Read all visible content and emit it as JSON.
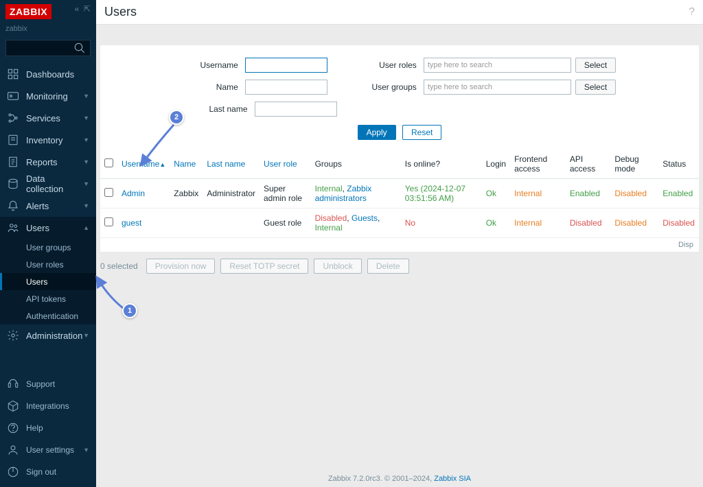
{
  "brand": "ZABBIX",
  "server_name": "zabbix",
  "page_title": "Users",
  "nav": {
    "dashboards": "Dashboards",
    "monitoring": "Monitoring",
    "services": "Services",
    "inventory": "Inventory",
    "reports": "Reports",
    "data_collection": "Data collection",
    "alerts": "Alerts",
    "users": "Users",
    "administration": "Administration",
    "users_sub": {
      "user_groups": "User groups",
      "user_roles": "User roles",
      "users": "Users",
      "api_tokens": "API tokens",
      "authentication": "Authentication"
    },
    "support": "Support",
    "integrations": "Integrations",
    "help": "Help",
    "user_settings": "User settings",
    "sign_out": "Sign out"
  },
  "filter": {
    "username_label": "Username",
    "name_label": "Name",
    "lastname_label": "Last name",
    "userroles_label": "User roles",
    "usergroups_label": "User groups",
    "placeholder_search": "type here to search",
    "select_btn": "Select",
    "apply_btn": "Apply",
    "reset_btn": "Reset"
  },
  "columns": {
    "username": "Username",
    "name": "Name",
    "lastname": "Last name",
    "userrole": "User role",
    "groups": "Groups",
    "online": "Is online?",
    "login": "Login",
    "frontend": "Frontend access",
    "api": "API access",
    "debug": "Debug mode",
    "status": "Status"
  },
  "rows": [
    {
      "username": "Admin",
      "name": "Zabbix",
      "lastname": "Administrator",
      "role": "Super admin role",
      "groups": [
        {
          "t": "Internal",
          "c": "green"
        },
        {
          "t": ", ",
          "c": ""
        },
        {
          "t": "Zabbix administrators",
          "c": "link"
        }
      ],
      "online": {
        "t": "Yes (2024-12-07 03:51:56 AM)",
        "c": "green"
      },
      "login": {
        "t": "Ok",
        "c": "green"
      },
      "frontend": {
        "t": "Internal",
        "c": "orange"
      },
      "api": {
        "t": "Enabled",
        "c": "green"
      },
      "debug": {
        "t": "Disabled",
        "c": "orange"
      },
      "status": {
        "t": "Enabled",
        "c": "green"
      }
    },
    {
      "username": "guest",
      "name": "",
      "lastname": "",
      "role": "Guest role",
      "groups": [
        {
          "t": "Disabled",
          "c": "red"
        },
        {
          "t": ", ",
          "c": ""
        },
        {
          "t": "Guests",
          "c": "link"
        },
        {
          "t": ", ",
          "c": ""
        },
        {
          "t": "Internal",
          "c": "green"
        }
      ],
      "online": {
        "t": "No",
        "c": "red"
      },
      "login": {
        "t": "Ok",
        "c": "green"
      },
      "frontend": {
        "t": "Internal",
        "c": "orange"
      },
      "api": {
        "t": "Disabled",
        "c": "red"
      },
      "debug": {
        "t": "Disabled",
        "c": "orange"
      },
      "status": {
        "t": "Disabled",
        "c": "red"
      }
    }
  ],
  "table_footer": "Disp",
  "action_bar": {
    "selected": "0 selected",
    "provision": "Provision now",
    "reset_totp": "Reset TOTP secret",
    "unblock": "Unblock",
    "delete": "Delete"
  },
  "footer": {
    "text": "Zabbix 7.2.0rc3. © 2001–2024, ",
    "link": "Zabbix SIA"
  },
  "annotations": {
    "a1": "1",
    "a2": "2"
  }
}
